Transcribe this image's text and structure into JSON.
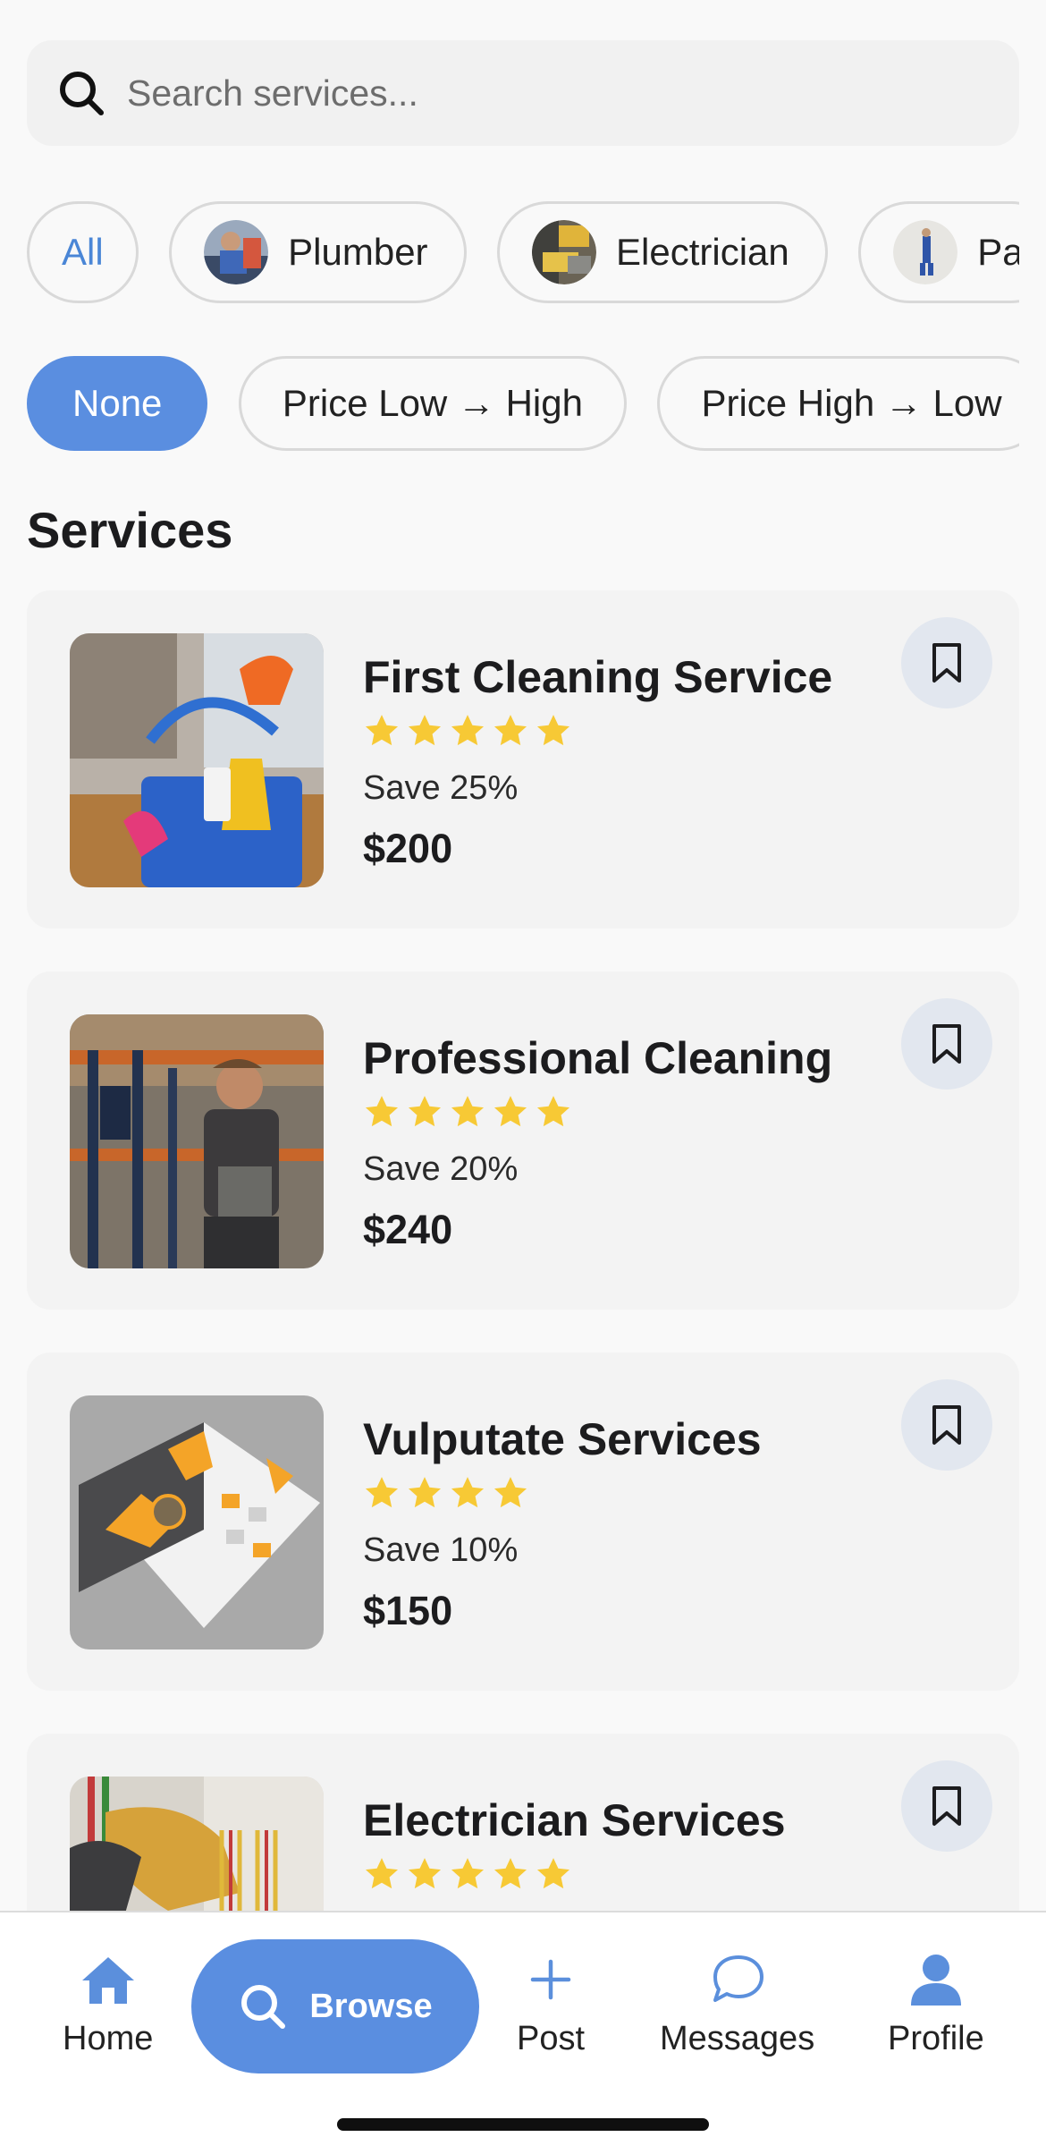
{
  "search": {
    "placeholder": "Search services..."
  },
  "categories": [
    {
      "label": "All",
      "active": true
    },
    {
      "label": "Plumber"
    },
    {
      "label": "Electrician"
    },
    {
      "label": "Pa"
    }
  ],
  "sort_options": [
    {
      "label": "None",
      "active": true
    },
    {
      "label": "Price Low → High"
    },
    {
      "label": "Price High → Low"
    }
  ],
  "section_title": "Services",
  "services": [
    {
      "name": "First Cleaning Service",
      "rating": 5,
      "discount": "Save 25%",
      "price": "$200"
    },
    {
      "name": "Professional Cleaning",
      "rating": 5,
      "discount": "Save 20%",
      "price": "$240"
    },
    {
      "name": "Vulputate Services",
      "rating": 4,
      "discount": "Save 10%",
      "price": "$150"
    },
    {
      "name": "Electrician Services",
      "rating": 5
    }
  ],
  "tabbar": {
    "home": "Home",
    "browse": "Browse",
    "post": "Post",
    "messages": "Messages",
    "profile": "Profile"
  },
  "colors": {
    "accent": "#5a8ee0",
    "star": "#f7c935",
    "icon_blue": "#5b8fdc"
  }
}
